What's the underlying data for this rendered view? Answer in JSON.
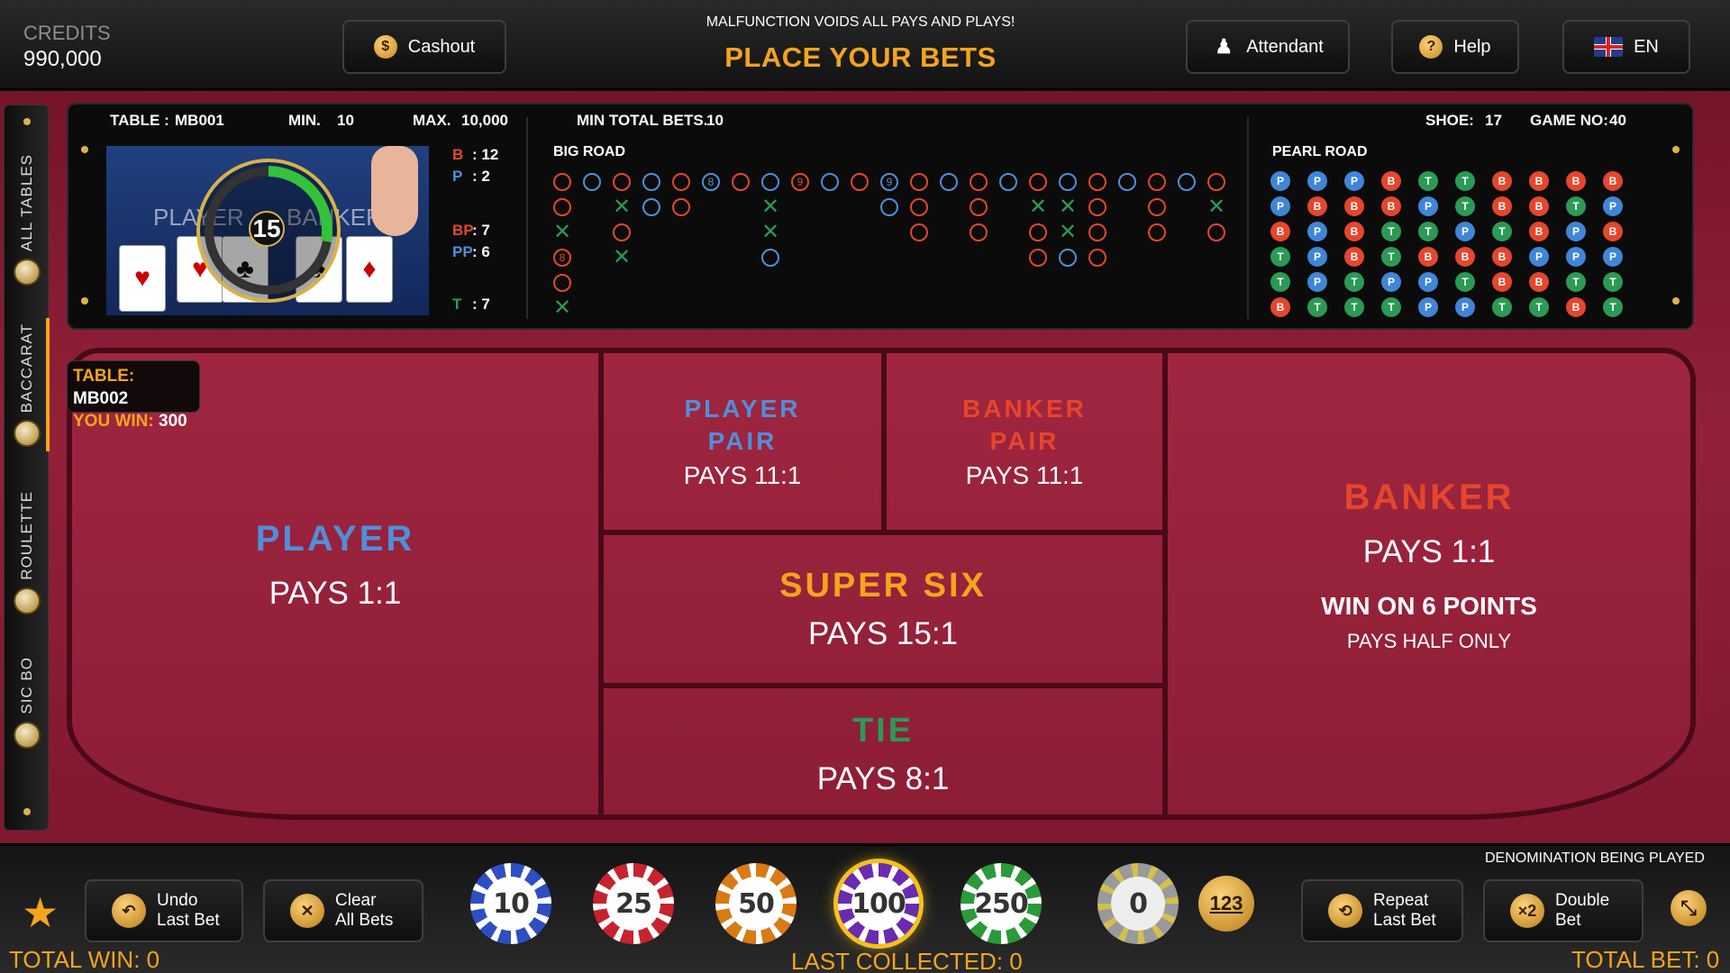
{
  "header": {
    "credits_label": "CREDITS",
    "credits_value": "990,000",
    "cashout_label": "Cashout",
    "notice": "MALFUNCTION VOIDS ALL PAYS AND PLAYS!",
    "status": "PLACE YOUR BETS",
    "attendant_label": "Attendant",
    "help_label": "Help",
    "language_label": "EN"
  },
  "sidebar": {
    "items": [
      {
        "label": "ALL TABLES"
      },
      {
        "label": "BACCARAT"
      },
      {
        "label": "ROULETTE"
      },
      {
        "label": "SIC BO"
      }
    ]
  },
  "info": {
    "table_label": "TABLE :",
    "table_value": "MB001",
    "min_label": "MIN.",
    "min_value": "10",
    "max_label": "MAX.",
    "max_value": "10,000",
    "mintotal_label": "MIN TOTAL BETS.",
    "mintotal_value": "10",
    "shoe_label": "SHOE:",
    "shoe_value": "17",
    "game_label": "GAME NO:",
    "game_value": "40"
  },
  "video": {
    "timer": "15",
    "player_text": "PLAYER",
    "banker_text": "BANKER"
  },
  "stats": {
    "b_label": "B",
    "b_value": ": 12",
    "p_label": "P",
    "p_value": ": 2",
    "bp_label": "BP",
    "bp_value": ": 7",
    "pp_label": "PP",
    "pp_value": ": 6",
    "t_label": "T",
    "t_value": ": 7"
  },
  "roads": {
    "big_road_title": "BIG ROAD",
    "pearl_road_title": "PEARL ROAD"
  },
  "win_badge": {
    "table_label": "TABLE:",
    "table_value": "MB002",
    "win_label": "YOU WIN:",
    "win_value": "300"
  },
  "bets": {
    "player": {
      "title": "PLAYER",
      "pays": "PAYS 1:1"
    },
    "player_pair": {
      "line1": "PLAYER",
      "line2": "PAIR",
      "pays": "PAYS 11:1"
    },
    "banker_pair": {
      "line1": "BANKER",
      "line2": "PAIR",
      "pays": "PAYS 11:1"
    },
    "super_six": {
      "title": "SUPER SIX",
      "pays": "PAYS 15:1"
    },
    "tie": {
      "title": "TIE",
      "pays": "PAYS 8:1"
    },
    "banker": {
      "title": "BANKER",
      "pays": "PAYS 1:1",
      "note1": "WIN ON 6 POINTS",
      "note2": "PAYS HALF ONLY"
    }
  },
  "footer": {
    "denomination_label": "DENOMINATION BEING PLAYED",
    "undo_line1": "Undo",
    "undo_line2": "Last Bet",
    "clear_line1": "Clear",
    "clear_line2": "All Bets",
    "repeat_line1": "Repeat",
    "repeat_line2": "Last Bet",
    "double_line1": "Double",
    "double_line2": "Bet",
    "chips": [
      "10",
      "25",
      "50",
      "100",
      "250"
    ],
    "zero_chip": "0",
    "numeric_chip": "123",
    "total_win": "TOTAL WIN: 0",
    "last_collected": "LAST COLLECTED: 0",
    "total_bet": "TOTAL BET: 0"
  },
  "colors": {
    "accent": "#f3a51c",
    "player": "#4f8fd8",
    "banker": "#e5462c",
    "tie": "#2b9a55",
    "felt": "#93203a"
  }
}
